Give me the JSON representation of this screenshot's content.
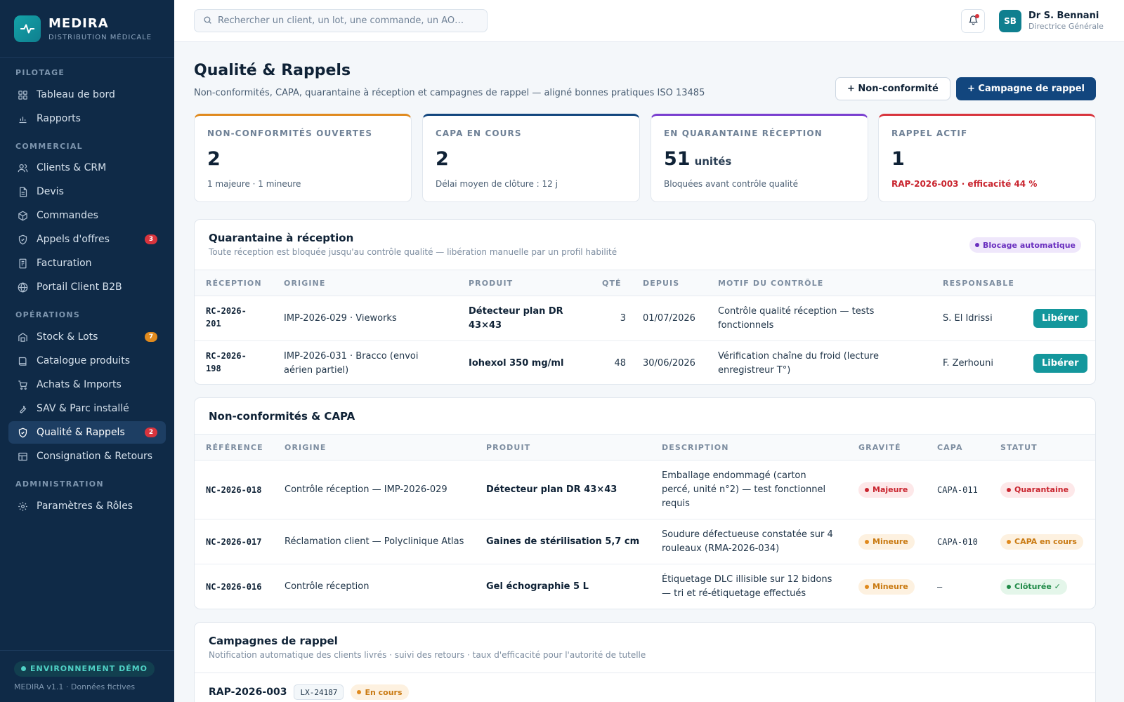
{
  "brand": {
    "name": "MEDIRA",
    "subtitle": "DISTRIBUTION MÉDICALE"
  },
  "nav": {
    "sections": [
      {
        "title": "PILOTAGE",
        "items": [
          {
            "label": "Tableau de bord",
            "icon": "grid-icon"
          },
          {
            "label": "Rapports",
            "icon": "chart-icon"
          }
        ]
      },
      {
        "title": "COMMERCIAL",
        "items": [
          {
            "label": "Clients & CRM",
            "icon": "users-icon"
          },
          {
            "label": "Devis",
            "icon": "document-icon"
          },
          {
            "label": "Commandes",
            "icon": "package-icon"
          },
          {
            "label": "Appels d'offres",
            "icon": "shield-icon",
            "badge": "3"
          },
          {
            "label": "Facturation",
            "icon": "invoice-icon"
          },
          {
            "label": "Portail Client B2B",
            "icon": "globe-icon"
          }
        ]
      },
      {
        "title": "OPÉRATIONS",
        "items": [
          {
            "label": "Stock & Lots",
            "icon": "warehouse-icon",
            "badge": "7"
          },
          {
            "label": "Catalogue produits",
            "icon": "book-icon"
          },
          {
            "label": "Achats & Imports",
            "icon": "cart-icon"
          },
          {
            "label": "SAV & Parc installé",
            "icon": "wrench-icon"
          },
          {
            "label": "Qualité & Rappels",
            "icon": "shield-check-icon",
            "badge": "2",
            "active": true
          },
          {
            "label": "Consignation & Retours",
            "icon": "storage-icon"
          }
        ]
      },
      {
        "title": "ADMINISTRATION",
        "items": [
          {
            "label": "Paramètres & Rôles",
            "icon": "gear-icon"
          }
        ]
      }
    ]
  },
  "footer": {
    "env": "ENVIRONNEMENT DÉMO",
    "version": "MEDIRA v1.1 · Données fictives"
  },
  "topbar": {
    "search_placeholder": "Rechercher un client, un lot, une commande, un AO…",
    "user": {
      "initials": "SB",
      "name": "Dr S. Bennani",
      "role": "Directrice Générale"
    }
  },
  "page": {
    "title": "Qualité & Rappels",
    "subtitle": "Non-conformités, CAPA, quarantaine à réception et campagnes de rappel — aligné bonnes pratiques ISO 13485",
    "btn_nc": "+ Non-conformité",
    "btn_recall": "+ Campagne de rappel"
  },
  "kpis": [
    {
      "label": "NON-CONFORMITÉS OUVERTES",
      "value": "2",
      "unit": "",
      "note": "1 majeure · 1 mineure",
      "accent": "#e08a1e"
    },
    {
      "label": "CAPA EN COURS",
      "value": "2",
      "unit": "",
      "note": "Délai moyen de clôture : 12 j",
      "accent": "#12467e"
    },
    {
      "label": "EN QUARANTAINE RÉCEPTION",
      "value": "51",
      "unit": "unités",
      "note": "Bloquées avant contrôle qualité",
      "accent": "#7a3fd0"
    },
    {
      "label": "RAPPEL ACTIF",
      "value": "1",
      "unit": "",
      "note": "RAP-2026-003 · efficacité 44 %",
      "accent": "#d8343d"
    }
  ],
  "quarantine": {
    "title": "Quarantaine à réception",
    "subtitle": "Toute réception est bloquée jusqu'au contrôle qualité — libération manuelle par un profil habilité",
    "badge": "Blocage automatique",
    "columns": [
      "RÉCEPTION",
      "ORIGINE",
      "PRODUIT",
      "QTÉ",
      "DEPUIS",
      "MOTIF DU CONTRÔLE",
      "RESPONSABLE"
    ],
    "rows": [
      {
        "ref": "RC-2026-\n201",
        "origin": "IMP-2026-029 · Vieworks",
        "product": "Détecteur plan DR 43×43",
        "qty": "3",
        "since": "01/07/2026",
        "reason": "Contrôle qualité réception — tests fonctionnels",
        "owner": "S. El Idrissi",
        "action": "Libérer"
      },
      {
        "ref": "RC-2026-\n198",
        "origin": "IMP-2026-031 · Bracco (envoi aérien partiel)",
        "product": "Iohexol 350 mg/ml",
        "qty": "48",
        "since": "30/06/2026",
        "reason": "Vérification chaîne du froid (lecture enregistreur T°)",
        "owner": "F. Zerhouni",
        "action": "Libérer"
      }
    ]
  },
  "nc": {
    "title": "Non-conformités & CAPA",
    "columns": [
      "RÉFÉRENCE",
      "ORIGINE",
      "PRODUIT",
      "DESCRIPTION",
      "GRAVITÉ",
      "CAPA",
      "STATUT"
    ],
    "rows": [
      {
        "ref": "NC-2026-018",
        "origin": "Contrôle réception — IMP-2026-029",
        "product": "Détecteur plan DR 43×43",
        "desc": "Emballage endommagé (carton percé, unité n°2) — test fonctionnel requis",
        "severity": "Majeure",
        "severity_type": "red",
        "capa": "CAPA-011",
        "status": "Quarantaine",
        "status_type": "red"
      },
      {
        "ref": "NC-2026-017",
        "origin": "Réclamation client — Polyclinique Atlas",
        "product": "Gaines de stérilisation 5,7 cm",
        "desc": "Soudure défectueuse constatée sur 4 rouleaux (RMA-2026-034)",
        "severity": "Mineure",
        "severity_type": "orange",
        "capa": "CAPA-010",
        "status": "CAPA en cours",
        "status_type": "orange"
      },
      {
        "ref": "NC-2026-016",
        "origin": "Contrôle réception",
        "product": "Gel échographie 5 L",
        "desc": "Étiquetage DLC illisible sur 12 bidons — tri et ré-étiquetage effectués",
        "severity": "Mineure",
        "severity_type": "orange",
        "capa": "–",
        "status": "Clôturée ✓",
        "status_type": "green"
      }
    ]
  },
  "recall": {
    "title": "Campagnes de rappel",
    "subtitle": "Notification automatique des clients livrés · suivi des retours · taux d'efficacité pour l'autorité de tutelle",
    "item": {
      "ref": "RAP-2026-003",
      "lot": "LX-24187",
      "status": "En cours"
    }
  }
}
